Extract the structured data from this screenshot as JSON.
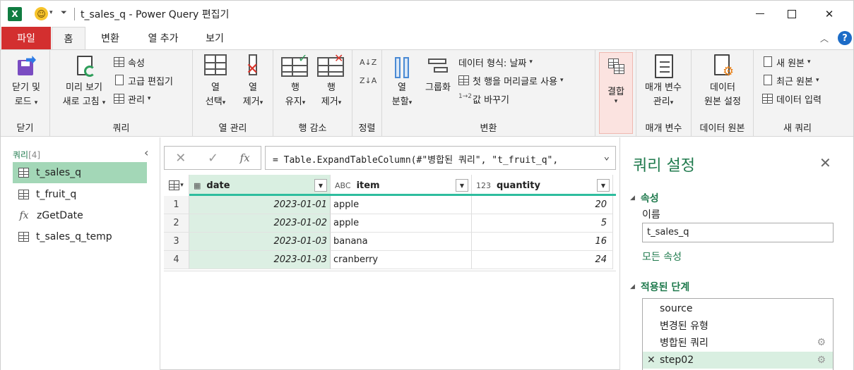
{
  "titlebar": {
    "app_logo": "X",
    "title": "t_sales_q - Power Query 편집기"
  },
  "tabs": [
    "파일",
    "홈",
    "변환",
    "열 추가",
    "보기"
  ],
  "ribbon": {
    "close": {
      "btn1": "닫기 및",
      "btn2": "로드",
      "label": "닫기"
    },
    "query": {
      "refresh1": "미리 보기",
      "refresh2": "새로 고침",
      "properties": "속성",
      "advanced_editor": "고급 편집기",
      "manage": "관리",
      "label": "쿼리"
    },
    "columns": {
      "choose1": "열",
      "choose2": "선택",
      "remove1": "열",
      "remove2": "제거",
      "label": "열 관리"
    },
    "rows": {
      "keep1": "행",
      "keep2": "유지",
      "remove1": "행",
      "remove2": "제거",
      "label": "행 감소"
    },
    "sort": {
      "label": "정렬"
    },
    "transform": {
      "split1": "열",
      "split2": "분할",
      "group_by": "그룹화",
      "data_type": "데이터 형식: 날짜",
      "first_row_header": "첫 행을 머리글로 사용",
      "replace_values": "값 바꾸기",
      "label": "변환"
    },
    "combine": {
      "btn": "결합"
    },
    "params": {
      "btn1": "매개 변수",
      "btn2": "관리",
      "label": "매개 변수"
    },
    "datasource": {
      "btn1": "데이터",
      "btn2": "원본 설정",
      "label": "데이터 원본"
    },
    "newquery": {
      "new_source": "새 원본",
      "recent_sources": "최근 원본",
      "enter_data": "데이터 입력",
      "label": "새 쿼리"
    }
  },
  "queries": {
    "header": "쿼리",
    "count": "[4]",
    "items": [
      {
        "name": "t_sales_q",
        "icon": "table-icon",
        "selected": true
      },
      {
        "name": "t_fruit_q",
        "icon": "table-icon",
        "selected": false
      },
      {
        "name": "zGetDate",
        "icon": "function-icon",
        "selected": false
      },
      {
        "name": "t_sales_q_temp",
        "icon": "table-icon",
        "selected": false
      }
    ]
  },
  "formula": {
    "text": "= Table.ExpandTableColumn(#\"병합된 쿼리\", \"t_fruit_q\","
  },
  "table": {
    "columns": [
      {
        "name": "date",
        "type": "date"
      },
      {
        "name": "item",
        "type": "ABC"
      },
      {
        "name": "quantity",
        "type": "123"
      }
    ],
    "rows": [
      {
        "n": "1",
        "date": "2023-01-01",
        "item": "apple",
        "quantity": "20"
      },
      {
        "n": "2",
        "date": "2023-01-02",
        "item": "apple",
        "quantity": "5"
      },
      {
        "n": "3",
        "date": "2023-01-03",
        "item": "banana",
        "quantity": "16"
      },
      {
        "n": "4",
        "date": "2023-01-03",
        "item": "cranberry",
        "quantity": "24"
      }
    ]
  },
  "settings": {
    "title": "쿼리 설정",
    "properties_header": "속성",
    "name_label": "이름",
    "name_value": "t_sales_q",
    "all_properties": "모든 속성",
    "steps_header": "적용된 단계",
    "steps": [
      {
        "name": "source",
        "gear": false,
        "selected": false
      },
      {
        "name": "변경된 유형",
        "gear": false,
        "selected": false
      },
      {
        "name": "병합된 쿼리",
        "gear": true,
        "selected": false
      },
      {
        "name": "step02",
        "gear": true,
        "selected": true
      }
    ]
  },
  "colors": {
    "accent_green": "#1f7a4d",
    "file_tab": "#d32f2f",
    "selected_query": "#a3d7b7",
    "column_bar": "#2ebd9e"
  }
}
